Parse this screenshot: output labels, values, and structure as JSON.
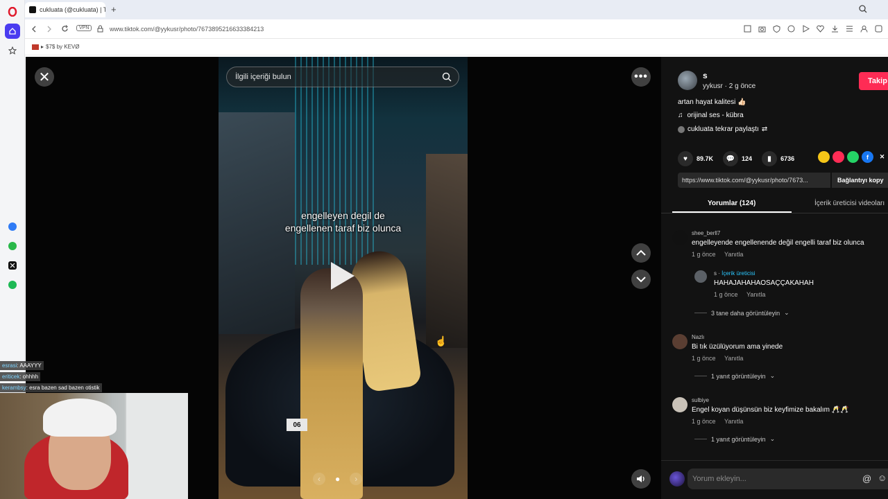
{
  "browser": {
    "tab_title": "cukluata (@cukluata) | Tik",
    "tab_close": "×",
    "new_tab": "+",
    "vpn_label": "VPN",
    "url": "www.tiktok.com/@yykusr/photo/7673895216633384213",
    "bookmark_label": "$7$ by KEVØ"
  },
  "viewer": {
    "search_placeholder": "İlgili içeriği bulun",
    "overlay_text_line1": "engelleyen degil de",
    "overlay_text_line2": "engellenen taraf biz olunca",
    "plate_text": "06",
    "close_glyph": "✕",
    "more_glyph": "•••"
  },
  "post": {
    "author_name": "s",
    "author_meta": "yykusr · 2 g önce",
    "follow_label": "Takip",
    "description": "artan hayat kalitesi 👍🏻",
    "music": "orijinal ses - kübra",
    "repost": "cukluata tekrar paylaştı",
    "likes": "89.7K",
    "comments_count": "124",
    "saves": "6736",
    "link": "https://www.tiktok.com/@yykusr/photo/7673...",
    "copy_label": "Bağlantıyı kopy",
    "tab_comments": "Yorumlar (124)",
    "tab_creator": "İçerik üreticisi videoları"
  },
  "comments": [
    {
      "name": "shee_berll7",
      "text": "engelleyende engellenende değil engelli taraf biz olunca",
      "time": "1 g önce",
      "reply": "Yanıtla"
    },
    {
      "name": "s · ",
      "creator": "İçerik üreticisi",
      "text": "HAHAJAHAHAOSAÇÇAKAHAH",
      "time": "1 g önce",
      "reply": "Yanıtla"
    },
    {
      "name": "Nazlı",
      "text": "Bi tık üzülüyorum ama yinede",
      "time": "1 g önce",
      "reply": "Yanıtla"
    },
    {
      "name": "sulbiye",
      "text": "Engel koyan düşünsün biz keyfimize bakalım 🥂🥂",
      "time": "1 g önce",
      "reply": "Yanıtla"
    }
  ],
  "more_replies": [
    "3 tane daha görüntüleyin",
    "1 yanıt görüntüleyin",
    "1 yanıt görüntüleyin"
  ],
  "comment_input_placeholder": "Yorum ekleyin...",
  "comment_at": "@",
  "comment_emoji": "☺",
  "stream_chat": [
    {
      "user": "esrasi",
      "text": ": AAAYYY"
    },
    {
      "user": "eriticek",
      "text": ": ohhhh"
    },
    {
      "user": "kerambsy",
      "text": ": esra bazen sad bazen otistik"
    }
  ],
  "icons": {
    "accent": "#fe2c55",
    "creator_color": "#2bc8ff"
  }
}
